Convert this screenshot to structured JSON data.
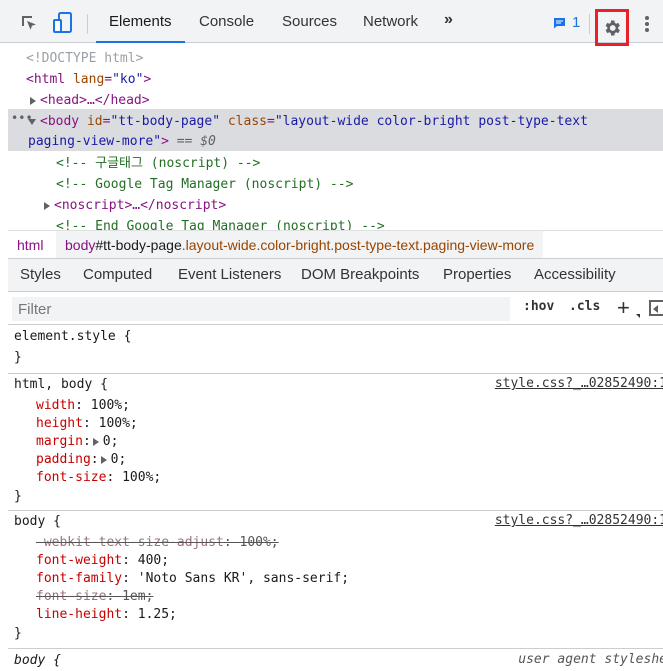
{
  "toolbar": {
    "tabs": [
      "Elements",
      "Console",
      "Sources",
      "Network"
    ],
    "more_tabs": "»",
    "message_count": "1"
  },
  "dom": {
    "doctype": "<!DOCTYPE html>",
    "html_open": "<html",
    "html_attr": "lang",
    "html_val": "\"ko\"",
    "html_close": ">",
    "head": "<head>…</head>",
    "body_tag": "<body",
    "body_id_attr": "id",
    "body_id_val": "\"tt-body-page\"",
    "body_class_attr": "class",
    "body_class_val_1": "\"layout-wide color-bright post-type-text",
    "body_class_val_2": "paging-view-more\"",
    "body_close": ">",
    "body_eq": "== $0",
    "comment1": "<!-- 구글태그 (noscript) -->",
    "comment2": "<!-- Google Tag Manager (noscript) -->",
    "noscript": "<noscript>…</noscript>",
    "comment3": "<!-- End Google Tag Manager (noscript) -->",
    "selected_dots": "•••"
  },
  "breadcrumb": {
    "html": "html",
    "body_tag": "body",
    "body_id": "#tt-body-page",
    "body_classes": ".layout-wide.color-bright.post-type-text.paging-view-more"
  },
  "subtabs": [
    "Styles",
    "Computed",
    "Event Listeners",
    "DOM Breakpoints",
    "Properties",
    "Accessibility"
  ],
  "filter": {
    "placeholder": "Filter",
    "hov": ":hov",
    "cls": ".cls",
    "plus": "+"
  },
  "styles": {
    "element_style": "element.style {",
    "close": "}",
    "rule1": {
      "selector": "html, body {",
      "source": "style.css?_…02852490:1",
      "decls": [
        {
          "prop": "width",
          "val": "100%;"
        },
        {
          "prop": "height",
          "val": "100%;"
        },
        {
          "prop": "margin",
          "val": "0;"
        },
        {
          "prop": "padding",
          "val": "0;"
        },
        {
          "prop": "font-size",
          "val": "100%;"
        }
      ]
    },
    "rule2": {
      "selector": "body {",
      "source": "style.css?_…02852490:1",
      "decls": [
        {
          "prop": "-webkit-text-size-adjust",
          "val": "100%;"
        },
        {
          "prop": "font-weight",
          "val": "400;"
        },
        {
          "prop": "font-family",
          "val": "'Noto Sans KR', sans-serif;"
        },
        {
          "prop": "font-size",
          "val": "1em;"
        },
        {
          "prop": "line-height",
          "val": "1.25;"
        }
      ]
    },
    "rule3": {
      "selector": "body {",
      "source": "user agent styleshe"
    }
  },
  "colors": {
    "accent": "#1a73e8",
    "highlight_box": "#e8202a"
  }
}
